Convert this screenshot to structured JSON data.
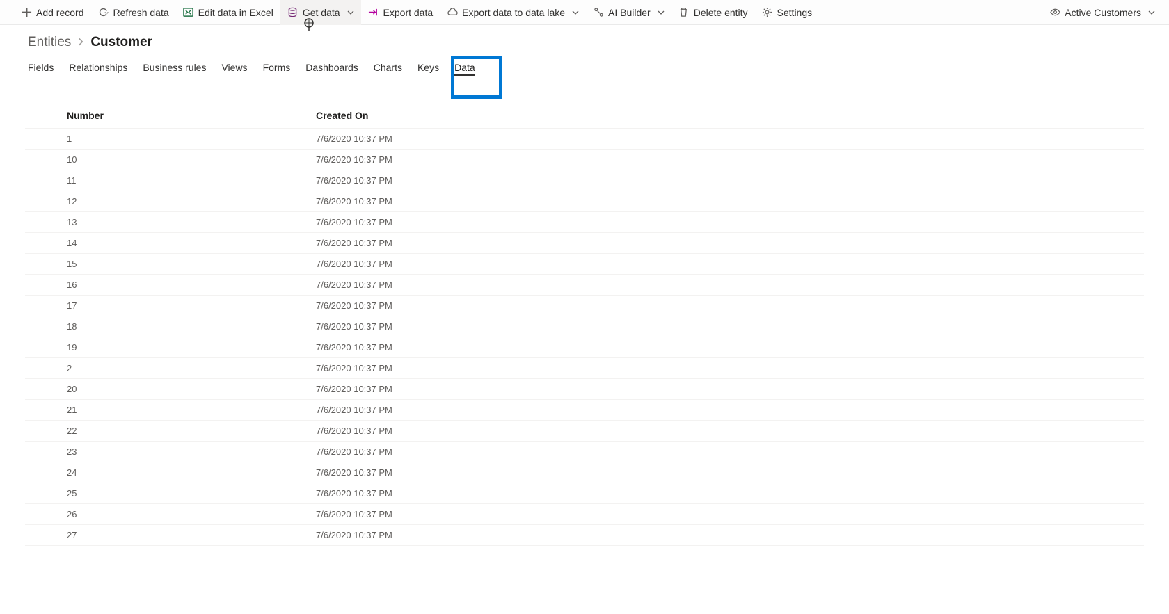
{
  "command_bar": {
    "add_record": "Add record",
    "refresh_data": "Refresh data",
    "edit_in_excel": "Edit data in Excel",
    "get_data": "Get data",
    "export_data": "Export data",
    "export_data_lake": "Export data to data lake",
    "ai_builder": "AI Builder",
    "delete_entity": "Delete entity",
    "settings": "Settings",
    "active_customers": "Active Customers"
  },
  "breadcrumb": {
    "root": "Entities",
    "current": "Customer"
  },
  "tabs": {
    "fields": "Fields",
    "relationships": "Relationships",
    "business_rules": "Business rules",
    "views": "Views",
    "forms": "Forms",
    "dashboards": "Dashboards",
    "charts": "Charts",
    "keys": "Keys",
    "data": "Data",
    "active": "data"
  },
  "table": {
    "columns": {
      "number": "Number",
      "created_on": "Created On"
    },
    "created_value": "7/6/2020 10:37 PM",
    "rows": [
      {
        "number": "1"
      },
      {
        "number": "10"
      },
      {
        "number": "11"
      },
      {
        "number": "12"
      },
      {
        "number": "13"
      },
      {
        "number": "14"
      },
      {
        "number": "15"
      },
      {
        "number": "16"
      },
      {
        "number": "17"
      },
      {
        "number": "18"
      },
      {
        "number": "19"
      },
      {
        "number": "2"
      },
      {
        "number": "20"
      },
      {
        "number": "21"
      },
      {
        "number": "22"
      },
      {
        "number": "23"
      },
      {
        "number": "24"
      },
      {
        "number": "25"
      },
      {
        "number": "26"
      },
      {
        "number": "27"
      }
    ]
  }
}
